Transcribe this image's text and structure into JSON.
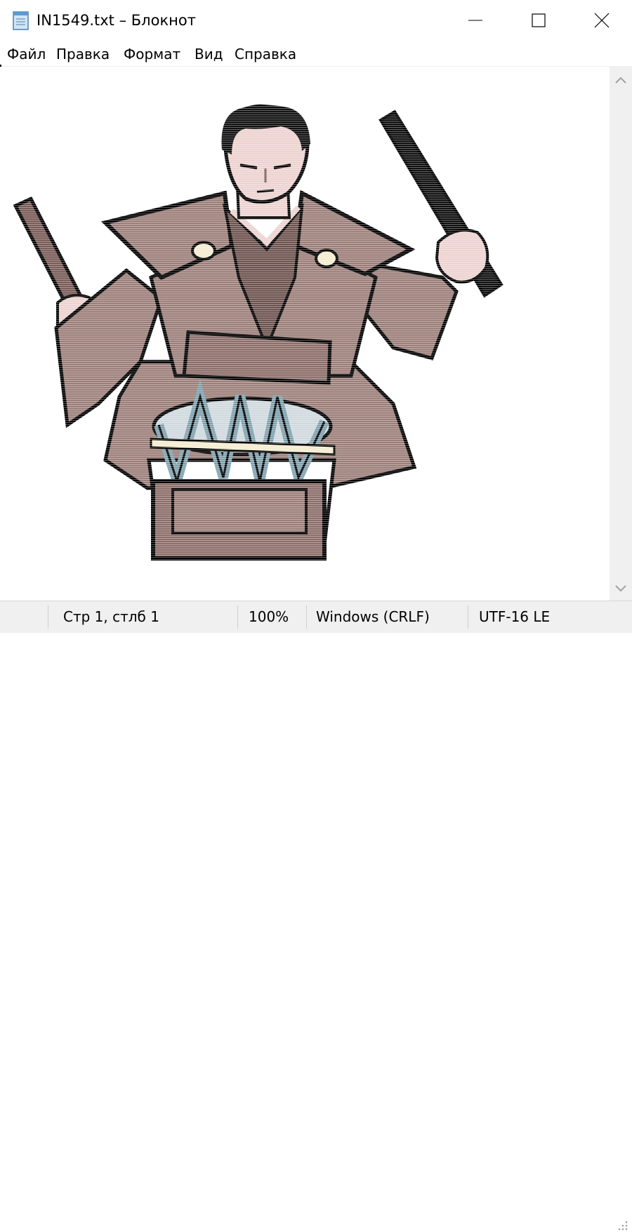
{
  "window": {
    "title": "IN1549.txt – Блокнот",
    "icons": {
      "app": "notepad-icon",
      "minimize": "minimize-icon",
      "maximize": "maximize-icon",
      "close": "close-icon"
    }
  },
  "menu": {
    "items": [
      {
        "label": "Файл"
      },
      {
        "label": "Правка"
      },
      {
        "label": "Формат"
      },
      {
        "label": "Вид"
      },
      {
        "label": "Справка"
      }
    ]
  },
  "editor": {
    "content_description_icon": "ascii-art-drummer",
    "colors": {
      "robe": "#9c7f7a",
      "skin": "#ecd2d0",
      "outline": "#000000",
      "drum_rope": "#7fa1ad"
    }
  },
  "statusbar": {
    "position": "Стр 1, стлб 1",
    "zoom": "100%",
    "line_ending": "Windows (CRLF)",
    "encoding": "UTF-16 LE"
  }
}
